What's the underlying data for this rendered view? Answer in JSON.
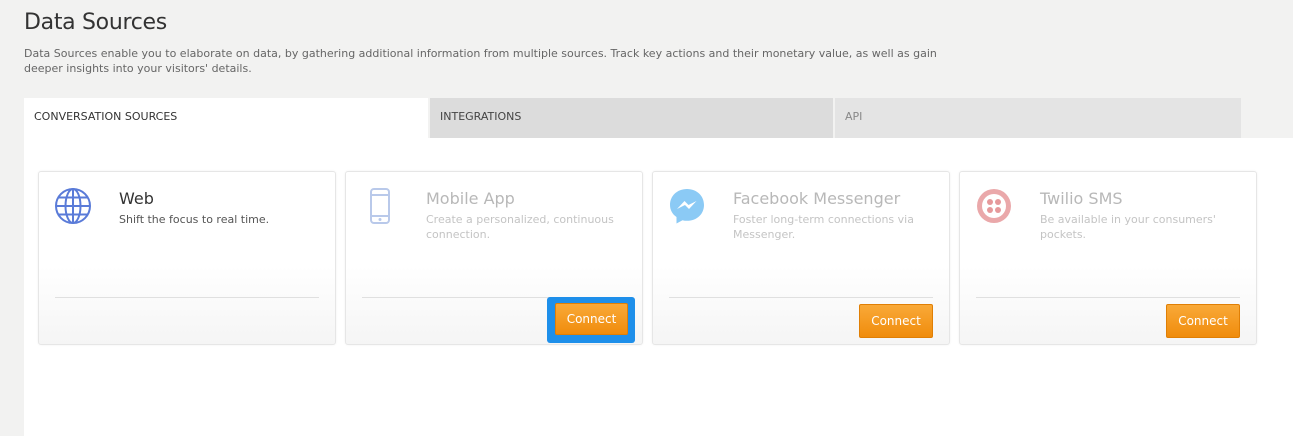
{
  "page": {
    "title": "Data Sources",
    "description": "Data Sources enable you to elaborate on data, by gathering additional information from multiple sources. Track key actions and their monetary value, as well as gain deeper insights into your visitors' details."
  },
  "tabs": [
    {
      "label": "CONVERSATION SOURCES",
      "active": true
    },
    {
      "label": "INTEGRATIONS",
      "active": false
    },
    {
      "label": "API",
      "active": false
    }
  ],
  "cards": [
    {
      "title": "Web",
      "description": "Shift the focus to real time.",
      "icon": "globe-icon",
      "enabled": true
    },
    {
      "title": "Mobile App",
      "description": "Create a personalized, continuous connection.",
      "icon": "mobile-phone-icon",
      "enabled": false,
      "button": "Connect",
      "highlighted": true
    },
    {
      "title": "Facebook Messenger",
      "description": "Foster long-term connections via Messenger.",
      "icon": "messenger-icon",
      "enabled": false,
      "button": "Connect"
    },
    {
      "title": "Twilio SMS",
      "description": "Be available in your consumers' pockets.",
      "icon": "twilio-icon",
      "enabled": false,
      "button": "Connect"
    }
  ],
  "colors": {
    "accent": "#f7a027",
    "highlight": "#1e8fea",
    "web_icon": "#5a7bd8",
    "messenger_icon": "#64b8f2",
    "twilio_icon": "#e6999b"
  }
}
